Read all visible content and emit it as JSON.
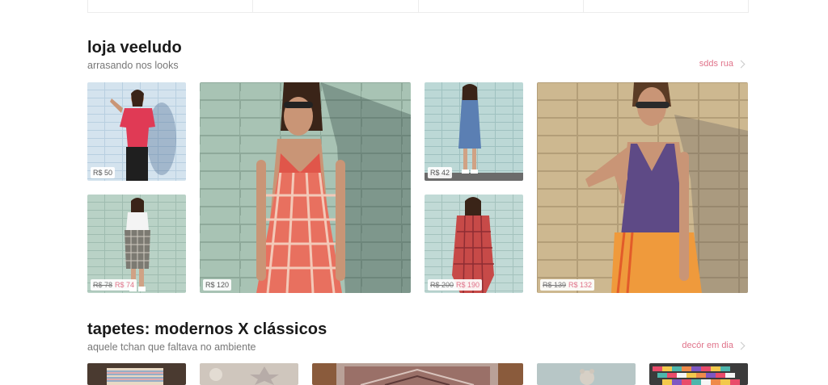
{
  "section1": {
    "title": "loja veeludo",
    "subtitle": "arrasando nos looks",
    "link": "sdds rua",
    "products": [
      {
        "price": "R$ 50"
      },
      {
        "old_price": "R$ 78",
        "price": "R$ 74"
      },
      {
        "price": "R$ 120"
      },
      {
        "price": "R$ 42"
      },
      {
        "old_price": "R$ 200",
        "price": "R$ 190"
      },
      {
        "old_price": "R$ 139",
        "price": "R$ 132"
      }
    ]
  },
  "section2": {
    "title": "tapetes: modernos X clássicos",
    "subtitle": "aquele tchan que faltava no ambiente",
    "link": "decór em dia"
  },
  "colors": {
    "accent": "#e0738a",
    "wall": "#a9c2b6",
    "wall_warm": "#cdb68f"
  }
}
